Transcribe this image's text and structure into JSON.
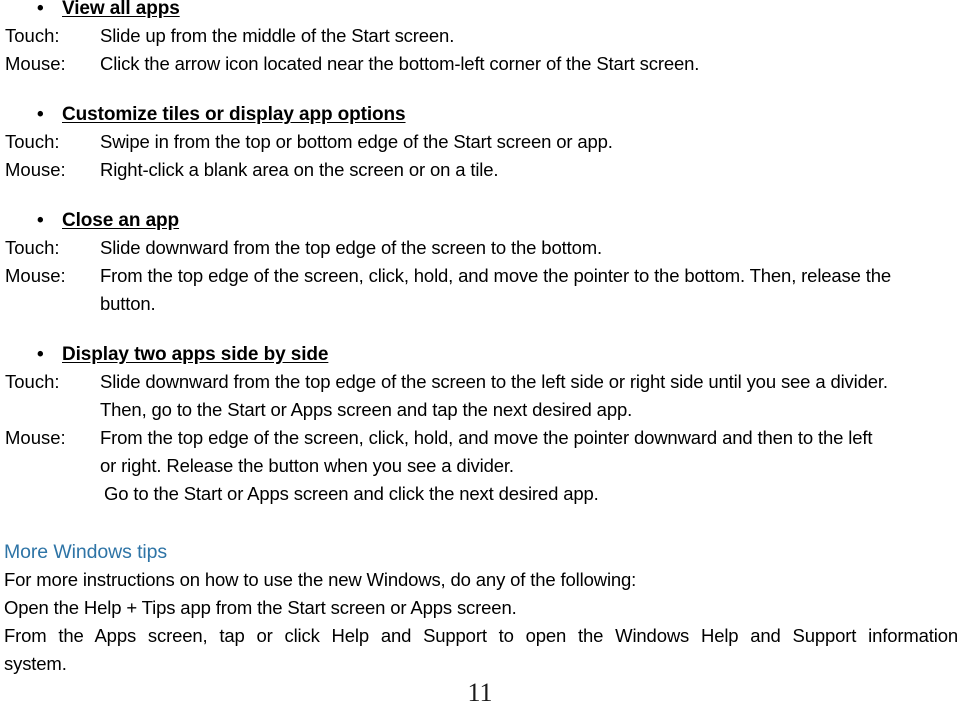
{
  "document": {
    "page_number": "11",
    "accent_color": "#2e74a6",
    "text_color": "#000000",
    "bullet_glyph": "•"
  },
  "sections": [
    {
      "heading": "View all apps",
      "steps": [
        {
          "label": "Touch:",
          "text": "Slide up from the middle of the Start screen."
        },
        {
          "label": "Mouse:",
          "text": "Click the arrow icon  located near the bottom-left corner of the Start screen."
        }
      ]
    },
    {
      "heading": "Customize tiles or display app options",
      "steps": [
        {
          "label": "Touch:",
          "text": "Swipe in from the top or bottom edge of the Start screen or app."
        },
        {
          "label": "Mouse:",
          "text": "Right-click a blank area on the screen or on a tile."
        }
      ]
    },
    {
      "heading": "Close an app",
      "steps": [
        {
          "label": "Touch:",
          "text": "Slide downward from the top edge of the screen to the bottom."
        },
        {
          "label": "Mouse:",
          "text": "From the top edge of the screen, click, hold, and move the pointer to the bottom. Then, release the",
          "continuation": [
            "button."
          ]
        }
      ]
    },
    {
      "heading": "Display two apps side by side",
      "steps": [
        {
          "label": "Touch:",
          "text": "Slide downward from the top edge of the screen to the left side or right side until you see a divider.",
          "continuation": [
            "Then, go to the Start or Apps screen and tap the next desired app."
          ]
        },
        {
          "label": "Mouse:",
          "text": "From the top edge of the screen, click, hold, and move the pointer downward and then to the left",
          "continuation": [
            "or right. Release the button when you see a divider.",
            "Go to the Start or Apps screen and click the next desired app."
          ]
        }
      ]
    }
  ],
  "tips": {
    "heading": "More Windows tips",
    "lines": [
      "For more instructions on how to use the new Windows, do any of the following:",
      "Open the Help + Tips app from the Start screen or Apps screen."
    ],
    "justified_line": "From the Apps screen, tap or click Help and Support to open the Windows Help and Support information",
    "justified_tail": "system."
  }
}
